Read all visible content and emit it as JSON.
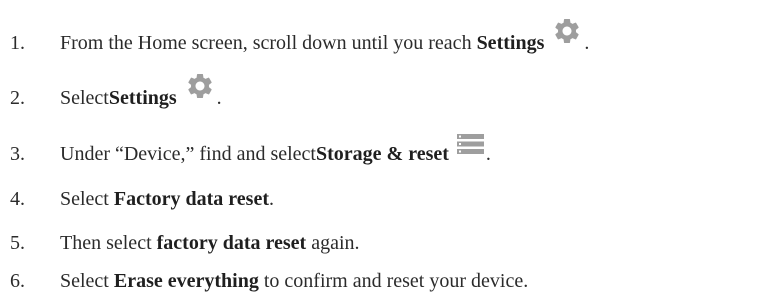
{
  "steps": [
    {
      "number": "1.",
      "pre": "From the Home screen, scroll down until you reach ",
      "bold": "Settings",
      "post": ".",
      "icon": "gear-icon"
    },
    {
      "number": "2.",
      "pre": "Select ",
      "bold": "Settings",
      "post": ".",
      "icon": "gear-icon"
    },
    {
      "number": "3.",
      "pre": "Under “Device,” find and select ",
      "bold": "Storage & reset",
      "post": ".",
      "icon": "storage-icon"
    },
    {
      "number": "4.",
      "pre": "Select ",
      "bold": "Factory data reset",
      "post": "."
    },
    {
      "number": "5.",
      "pre": "Then select ",
      "bold": "factory data reset",
      "post": " again."
    },
    {
      "number": "6.",
      "pre": "Select ",
      "bold": "Erase everything",
      "post": " to confirm and reset your device."
    }
  ],
  "colors": {
    "text": "#2b2b2b",
    "icon": "#9e9e9e"
  }
}
